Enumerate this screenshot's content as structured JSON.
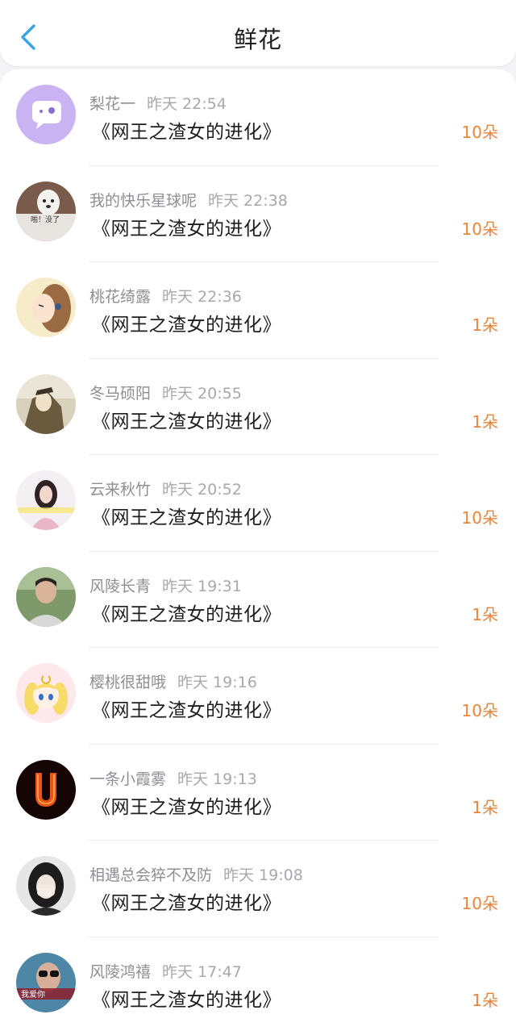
{
  "header": {
    "title": "鲜花",
    "accent": "#3aa3e8"
  },
  "list": {
    "count_color": "#e8853c",
    "items": [
      {
        "user": "梨花一",
        "time": "昨天 22:54",
        "book": "《网王之渣女的进化》",
        "count": "10朵",
        "avatar_icon": "chat-bubble-icon"
      },
      {
        "user": "我的快乐星球呢",
        "time": "昨天 22:38",
        "book": "《网王之渣女的进化》",
        "count": "10朵",
        "avatar_icon": "dog-avatar"
      },
      {
        "user": "桃花绮露",
        "time": "昨天 22:36",
        "book": "《网王之渣女的进化》",
        "count": "1朵",
        "avatar_icon": "girl-avatar"
      },
      {
        "user": "冬马硕阳",
        "time": "昨天 20:55",
        "book": "《网王之渣女的进化》",
        "count": "1朵",
        "avatar_icon": "anime-avatar"
      },
      {
        "user": "云来秋竹",
        "time": "昨天 20:52",
        "book": "《网王之渣女的进化》",
        "count": "10朵",
        "avatar_icon": "woman-photo-avatar"
      },
      {
        "user": "风陵长青",
        "time": "昨天 19:31",
        "book": "《网王之渣女的进化》",
        "count": "1朵",
        "avatar_icon": "man-photo-avatar"
      },
      {
        "user": "樱桃很甜哦",
        "time": "昨天 19:16",
        "book": "《网王之渣女的进化》",
        "count": "10朵",
        "avatar_icon": "sailor-moon-avatar"
      },
      {
        "user": "一条小霞雾",
        "time": "昨天 19:13",
        "book": "《网王之渣女的进化》",
        "count": "1朵",
        "avatar_icon": "fire-letter-avatar"
      },
      {
        "user": "相遇总会猝不及防",
        "time": "昨天 19:08",
        "book": "《网王之渣女的进化》",
        "count": "10朵",
        "avatar_icon": "covering-face-avatar"
      },
      {
        "user": "风陵鸿禧",
        "time": "昨天 17:47",
        "book": "《网王之渣女的进化》",
        "count": "1朵",
        "avatar_icon": "sunglasses-avatar"
      }
    ]
  }
}
